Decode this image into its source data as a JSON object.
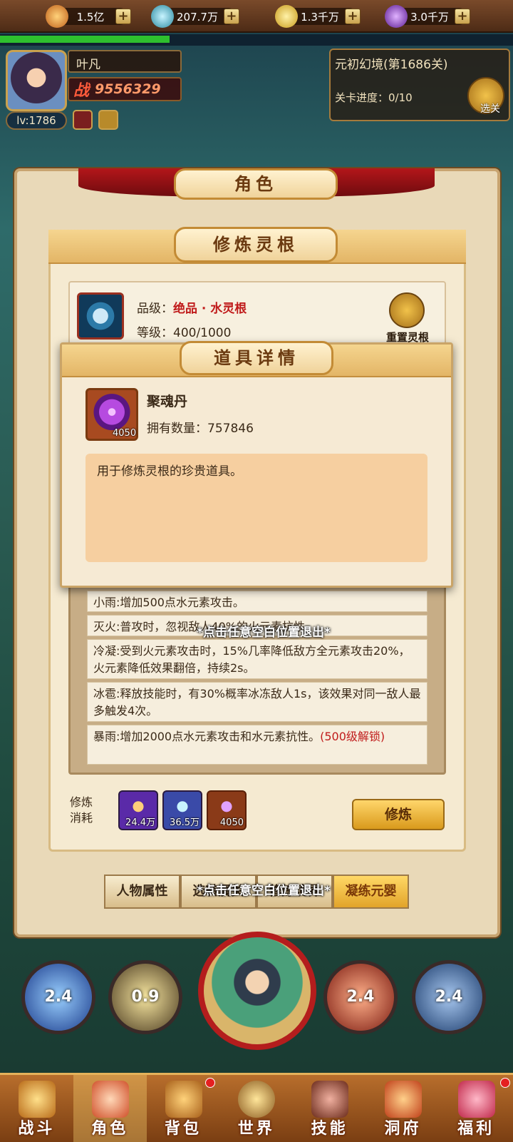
{
  "resources": [
    {
      "value": "1.5亿",
      "icon": "flame-gem-icon",
      "color": "#e8902a"
    },
    {
      "value": "207.7万",
      "icon": "cyan-orb-icon",
      "color": "#36b6c8"
    },
    {
      "value": "1.3千万",
      "icon": "gold-ingot-icon",
      "color": "#e8c43a"
    },
    {
      "value": "3.0千万",
      "icon": "purple-orb-icon",
      "color": "#8a3ac8"
    }
  ],
  "player": {
    "name": "叶凡",
    "power_label": "战",
    "power": "9556329",
    "level": "lv:1786"
  },
  "exp_progress": 0.33,
  "stage": {
    "title": "元初幻境(第1686关)",
    "progress": "关卡进度：0/10",
    "select_label": "选关"
  },
  "panel": {
    "title": "角色",
    "subtitle": "修炼灵根"
  },
  "root": {
    "grade_label": "品级：",
    "grade_value": "绝品 · 水灵根",
    "level_label": "等级：",
    "level_value": "400/1000",
    "reset_label": "重置灵根"
  },
  "popup": {
    "title": "道具详情",
    "item_name": "聚魂丹",
    "item_icon_count": "4050",
    "owned_label": "拥有数量：",
    "owned_value": "757846",
    "description": "用于修炼灵根的珍贵道具。"
  },
  "effects": [
    {
      "text": "小雨:增加500点水元素攻击。"
    },
    {
      "text": "灭火:普攻时，忽视敌人40%的火元素抗性。"
    },
    {
      "text": "冷凝:受到火元素攻击时，15%几率降低敌方全元素攻击20%，火元素降低效果翻倍，持续2s。"
    },
    {
      "text": "冰雹:释放技能时，有30%概率冰冻敌人1s，该效果对同一敌人最多触发4次。"
    },
    {
      "text": "暴雨:增加2000点水元素攻击和水元素抗性。",
      "lock": "(500级解锁)"
    }
  ],
  "cost": {
    "label": "修炼消耗",
    "items": [
      {
        "amount": "24.4万",
        "icon": "flame-gem-icon"
      },
      {
        "amount": "36.5万",
        "icon": "cyan-orb-icon"
      },
      {
        "amount": "4050",
        "icon": "soul-pill-icon"
      }
    ],
    "train_label": "修炼"
  },
  "tabs": [
    "人物属性",
    "选转属关",
    "修炼境界",
    "凝练元婴"
  ],
  "exit_hint": "*点击任意空白位置退出*",
  "skills": [
    "2.4",
    "0.9",
    "2.4",
    "2.4"
  ],
  "nav": [
    "战斗",
    "角色",
    "背包",
    "世界",
    "技能",
    "洞府",
    "福利"
  ]
}
